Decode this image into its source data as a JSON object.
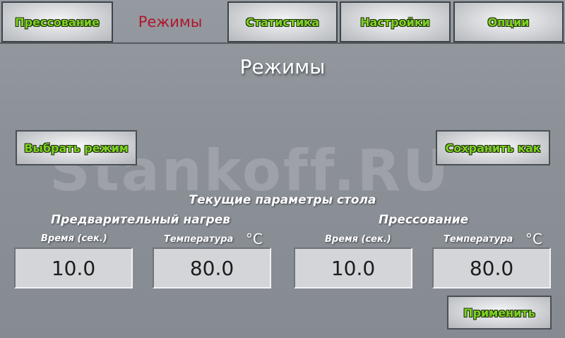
{
  "tabs": [
    {
      "label": "Прессование"
    },
    {
      "label": "Режимы",
      "active": true
    },
    {
      "label": "Статистика"
    },
    {
      "label": "Настройки"
    },
    {
      "label": "Опции"
    }
  ],
  "page_title": "Режимы",
  "buttons": {
    "select_mode": "Выбрать режим",
    "save_as": "Сохранить как",
    "apply": "Применить"
  },
  "watermark": "Stankoff.RU",
  "section_title": "Текущие параметры стола",
  "preheat": {
    "title": "Предварительный нагрев",
    "time_label": "Время (сек.)",
    "temp_label": "Температура",
    "temp_unit": "°C",
    "time_value": "10.0",
    "temp_value": "80.0"
  },
  "pressing": {
    "title": "Прессование",
    "time_label": "Время (сек.)",
    "temp_label": "Температура",
    "temp_unit": "°C",
    "time_value": "10.0",
    "temp_value": "80.0"
  },
  "colors": {
    "button_text": "#7ed321",
    "active_tab_text": "#b0162a",
    "background": "#8c9198"
  }
}
